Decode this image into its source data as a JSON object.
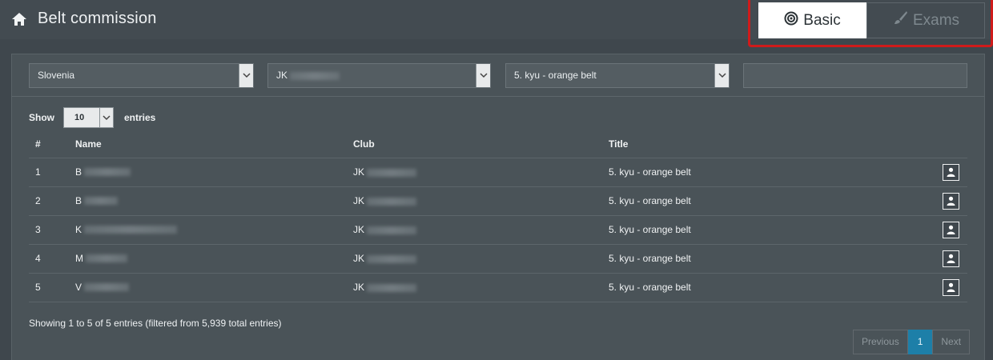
{
  "header": {
    "title": "Belt commission",
    "home_icon": "home-icon",
    "tabs": [
      {
        "label": "Basic",
        "icon": "target-icon",
        "active": true
      },
      {
        "label": "Exams",
        "icon": "brush-icon",
        "active": false
      }
    ],
    "highlight_color": "#d01b1b"
  },
  "filters": {
    "country": "Slovenia",
    "club": "JK",
    "title": "5. kyu - orange belt",
    "search_value": ""
  },
  "length_menu": {
    "show_label": "Show",
    "selected": "10",
    "entries_label": "entries"
  },
  "table": {
    "columns": [
      "#",
      "Name",
      "Club",
      "Title"
    ],
    "rows": [
      {
        "num": "1",
        "name": "B",
        "club": "JK",
        "title": "5. kyu - orange belt"
      },
      {
        "num": "2",
        "name": "B",
        "club": "JK",
        "title": "5. kyu - orange belt"
      },
      {
        "num": "3",
        "name": "K",
        "club": "JK",
        "title": "5. kyu - orange belt"
      },
      {
        "num": "4",
        "name": "M",
        "club": "JK",
        "title": "5. kyu - orange belt"
      },
      {
        "num": "5",
        "name": "V",
        "club": "JK",
        "title": "5. kyu - orange belt"
      }
    ]
  },
  "info": "Showing 1 to 5 of 5 entries (filtered from 5,939 total entries)",
  "pagination": {
    "previous": "Previous",
    "current": "1",
    "next": "Next",
    "accent": "#1d7fa8"
  }
}
